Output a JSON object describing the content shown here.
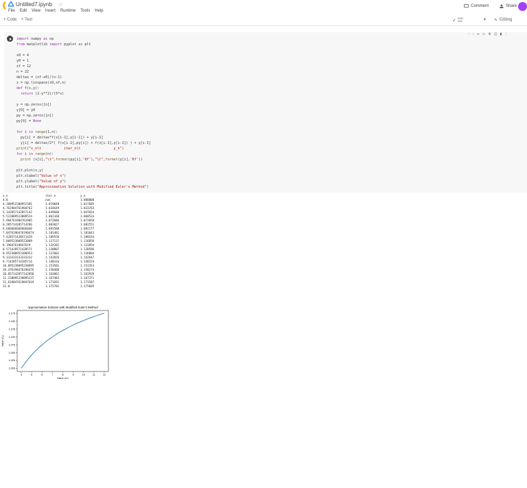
{
  "app": {
    "file_name": "Untitled7.ipynb",
    "menu": [
      "File",
      "Edit",
      "View",
      "Insert",
      "Runtime",
      "Tools",
      "Help"
    ],
    "comment_label": "Comment",
    "share_label": "Share",
    "add_code_label": "+ Code",
    "add_text_label": "+ Text",
    "ram_label": "RAM",
    "disk_label": "Disk",
    "editing_label": "Editing",
    "colors": {
      "accent": "#f9ab00",
      "avatar": "#a142f4",
      "plot_line": "#1f77b4"
    }
  },
  "code_lines": [
    "import numpy as np",
    "from matplotlib import pyplot as plt",
    "",
    "x0 = 4",
    "y0 = 1",
    "xf = 12",
    "n = 22",
    "deltax = (xf-x0)/(n-1)",
    "x = np.linspace(x0,xf,n)",
    "def f(x,y):",
    "  return (2-y**2)/(5*x)",
    "",
    "y = np.zeros([n])",
    "y[0] = y0",
    "py = np.zeros([n])",
    "py[0] = None",
    "",
    "for i in range(1,n):",
    "  py[i] = deltax*f(x[i-1],y[i-1]) + y[i-1]",
    "  y[i] = deltax/2*( f(x[i-1],py[i]) + f(x[i-1],y[i-1]) ) + y[i-1]",
    "print(\"x_n\\t           iter_n\\t                y_n\")",
    "for i in range(n):",
    "  print (x[i],\"\\t\",format(py[i],'6f'),\"\\t\",format(y[i],'6f'))",
    "",
    "plt.plot(x,y)",
    "plt.xlabel(\"Value of x\")",
    "plt.ylabel(\"Value of y\")",
    "plt.title(\"Approximation Solution with Modified Euler's Method\")"
  ],
  "output_table": {
    "headers": [
      "x_n",
      "iter_n",
      "y_n"
    ],
    "rows": [
      [
        "4.0",
        "nan",
        "1.000000"
      ],
      [
        "4.380952380952381",
        "1.019048",
        "1.017685"
      ],
      [
        "4.761904761904762",
        "1.034649",
        "1.033783"
      ],
      [
        "5.142857142857142",
        "1.049606",
        "1.047824"
      ],
      [
        "5.523809523809524",
        "1.061168",
        "1.060533"
      ],
      [
        "5.904761904761905",
        "1.072606",
        "1.072050"
      ],
      [
        "6.285714285714286",
        "1.083027",
        "1.082551"
      ],
      [
        "6.666666666666666",
        "1.092588",
        "1.092177"
      ],
      [
        "7.0476190476190474",
        "1.101401",
        "1.101043"
      ],
      [
        "7.428571428571429",
        "1.109558",
        "1.109244"
      ],
      [
        "7.809523809523809",
        "1.117137",
        "1.116858"
      ],
      [
        "8.19047619047619",
        "1.124201",
        "1.123954"
      ],
      [
        "8.571428571428571",
        "1.130807",
        "1.130586"
      ],
      [
        "8.952380952380953",
        "1.137002",
        "1.136804"
      ],
      [
        "9.333333333333332",
        "1.142826",
        "1.142647"
      ],
      [
        "9.714285714285714",
        "1.148316",
        "1.148154"
      ],
      [
        "10.095238095238095",
        "1.153501",
        "1.153353"
      ],
      [
        "10.476190476190476",
        "1.158408",
        "1.158274"
      ],
      [
        "10.857142857142858",
        "1.163062",
        "1.162939"
      ],
      [
        "11.238095238095237",
        "1.167483",
        "1.167371"
      ],
      [
        "11.619047619047619",
        "1.171691",
        "1.171587"
      ],
      [
        "12.0",
        "1.175701",
        "1.175605"
      ]
    ]
  },
  "chart_data": {
    "type": "line",
    "title": "Approximation Solution with Modified Euler's Method",
    "xlabel": "Value of x",
    "ylabel": "Value of y",
    "xlim": [
      3.6,
      12.4
    ],
    "ylim": [
      0.99,
      1.184
    ],
    "xticks": [
      4,
      5,
      6,
      7,
      8,
      9,
      10,
      11,
      12
    ],
    "yticks": [
      1.0,
      1.025,
      1.05,
      1.075,
      1.1,
      1.125,
      1.15,
      1.175
    ],
    "ytick_labels": [
      "1.000",
      "1.025",
      "1.050",
      "1.075",
      "1.100",
      "1.125",
      "1.150",
      "1.175"
    ],
    "grid": false,
    "series": [
      {
        "color": "#1f77b4",
        "x": [
          4.0,
          4.381,
          4.762,
          5.143,
          5.524,
          5.905,
          6.286,
          6.667,
          7.048,
          7.429,
          7.81,
          8.19,
          8.571,
          8.952,
          9.333,
          9.714,
          10.095,
          10.476,
          10.857,
          11.238,
          11.619,
          12.0
        ],
        "y": [
          1.0,
          1.017685,
          1.033783,
          1.047824,
          1.060533,
          1.07205,
          1.082551,
          1.092177,
          1.101043,
          1.109244,
          1.116858,
          1.123954,
          1.130586,
          1.136804,
          1.142647,
          1.148154,
          1.153353,
          1.158274,
          1.162939,
          1.167371,
          1.171587,
          1.175605
        ]
      }
    ]
  }
}
